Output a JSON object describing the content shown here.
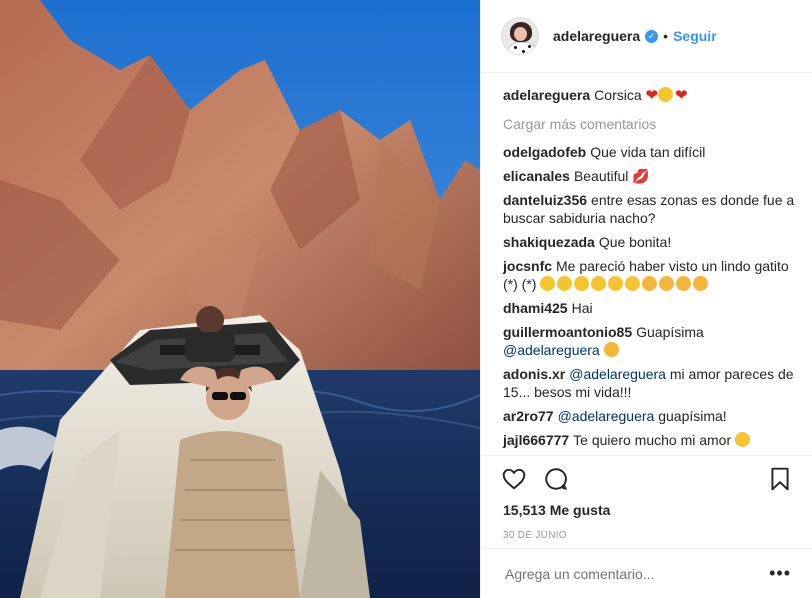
{
  "post": {
    "username": "adelareguera",
    "separator": "•",
    "follow_label": "Seguir",
    "caption_user": "adelareguera",
    "caption_text": "Corsica",
    "load_more": "Cargar más comentarios",
    "likes": "15,513 Me gusta",
    "date": "30 DE JUNIO",
    "add_comment_placeholder": "Agrega un comentario...",
    "more_glyph": "•••"
  },
  "comments": [
    {
      "user": "odelgadofeb",
      "text": "Que vida tan difícil"
    },
    {
      "user": "elicanales",
      "text": "Beautiful"
    },
    {
      "user": "danteluiz356",
      "text": "entre esas zonas es donde fue a buscar sabiduria nacho?"
    },
    {
      "user": "shakiquezada",
      "text": "Que bonita!"
    },
    {
      "user": "jocsnfc",
      "text": "Me pareció haber visto un lindo gatito (*) (*)"
    },
    {
      "user": "dhami425",
      "text": "Hai"
    },
    {
      "user": "guillermoantonio85",
      "text": "Guapísima",
      "mention": "@adelareguera"
    },
    {
      "user": "adonis.xr",
      "mention": "@adelareguera",
      "text": "mi amor pareces de 15... besos mi vida!!!"
    },
    {
      "user": "ar2ro77",
      "mention": "@adelareguera",
      "text": "guapísima!"
    },
    {
      "user": "jajl666777",
      "text": "Te quiero mucho mi amor"
    }
  ],
  "icons": {
    "like": "heart-outline-icon",
    "comment": "comment-bubble-icon",
    "save": "bookmark-icon",
    "verified": "verified-badge-icon"
  },
  "colors": {
    "link_blue": "#3897f0",
    "mention": "#003569",
    "muted": "#999999"
  }
}
